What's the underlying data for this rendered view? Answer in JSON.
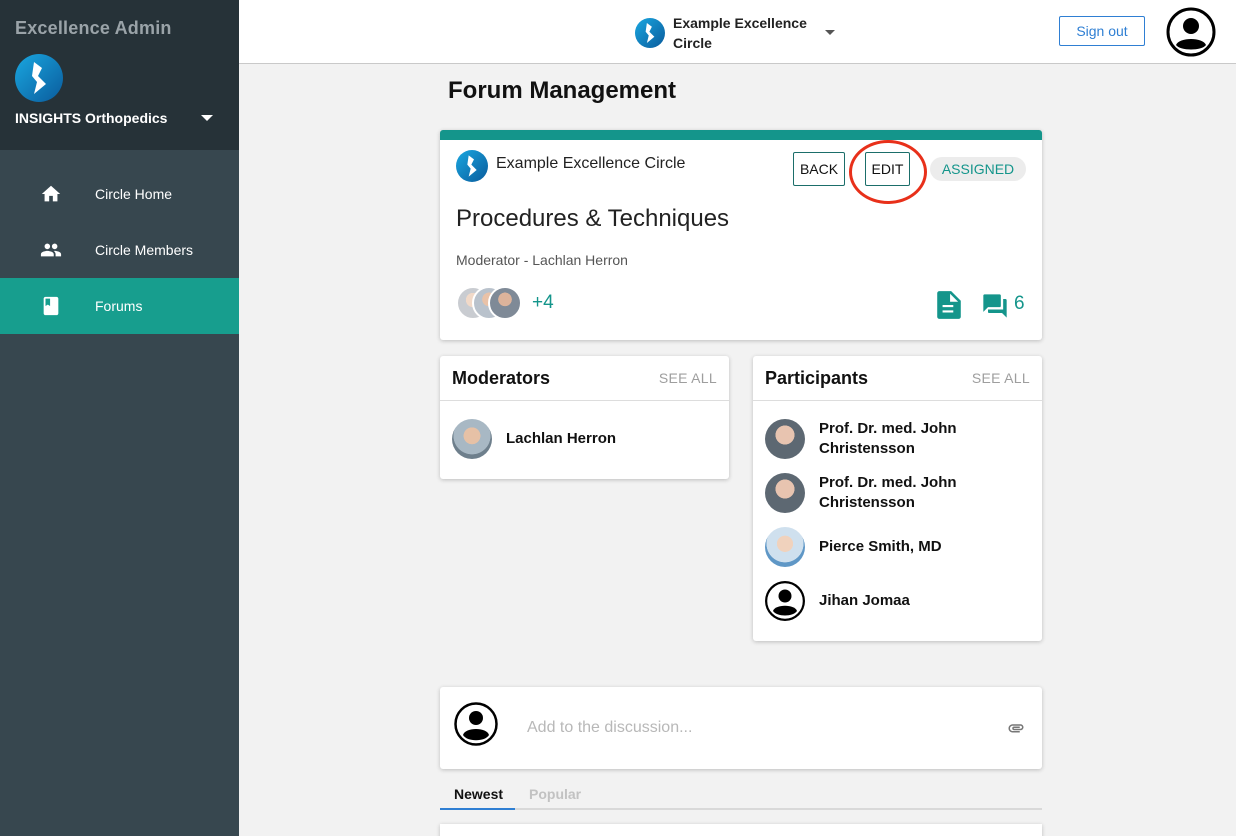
{
  "sidebar": {
    "admin_title": "Excellence Admin",
    "org_name": "INSIGHTS Orthopedics",
    "items": [
      {
        "label": "Circle Home",
        "icon": "home-icon"
      },
      {
        "label": "Circle Members",
        "icon": "people-icon"
      },
      {
        "label": "Forums",
        "icon": "book-icon",
        "active": true
      }
    ]
  },
  "topbar": {
    "circle_name": "Example Excellence Circle",
    "sign_out_label": "Sign out"
  },
  "page": {
    "title": "Forum Management"
  },
  "forum": {
    "circle_name": "Example Excellence Circle",
    "back_label": "BACK",
    "edit_label": "EDIT",
    "status_label": "ASSIGNED",
    "title": "Procedures & Techniques",
    "moderator_line": "Moderator - Lachlan Herron",
    "extra_members": "+4",
    "comment_count": "6"
  },
  "moderators": {
    "title": "Moderators",
    "see_all": "SEE ALL",
    "people": [
      {
        "name": "Lachlan Herron"
      }
    ]
  },
  "participants": {
    "title": "Participants",
    "see_all": "SEE ALL",
    "people": [
      {
        "name": "Prof. Dr. med. John Christensson"
      },
      {
        "name": "Prof. Dr. med. John Christensson"
      },
      {
        "name": "Pierce Smith, MD"
      },
      {
        "name": "Jihan Jomaa"
      }
    ]
  },
  "composer": {
    "placeholder": "Add to the discussion..."
  },
  "tabs": [
    {
      "label": "Newest",
      "active": true
    },
    {
      "label": "Popular"
    }
  ],
  "colors": {
    "accent": "#14958b",
    "sidebar": "#37474f",
    "sidebar_head": "#263238",
    "link_blue": "#2f7fd3",
    "highlight_ring": "#e8301a"
  }
}
